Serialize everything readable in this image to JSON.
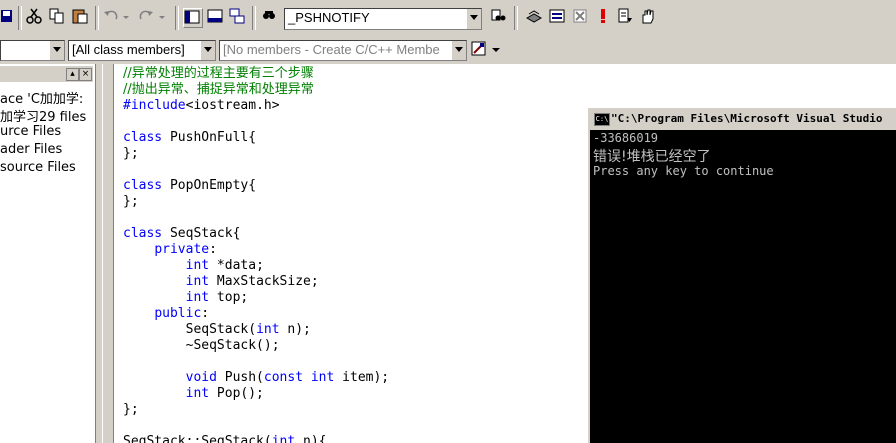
{
  "toolbar": {
    "find_combo_value": "_PSHNOTIFY"
  },
  "wizardbar": {
    "class_value": "",
    "filter_value": "[All class members]",
    "members_value": "[No members - Create C/C++ Membe"
  },
  "workspace": {
    "items": [
      "ace 'C加加学:",
      "加学习29 files",
      "urce Files",
      "ader Files",
      "source Files"
    ]
  },
  "editor": {
    "lines": [
      {
        "type": "comment",
        "text": "//异常处理的过程主要有三个步骤"
      },
      {
        "type": "comment",
        "text": "//抛出异常、捕捉异常和处理异常"
      },
      {
        "type": "include",
        "kw": "#include",
        "rest": "<iostream.h>"
      },
      {
        "type": "blank"
      },
      {
        "type": "kwline",
        "indent": "",
        "kw": "class",
        "rest": " PushOnFull{"
      },
      {
        "type": "plain",
        "text": "};"
      },
      {
        "type": "blank"
      },
      {
        "type": "kwline",
        "indent": "",
        "kw": "class",
        "rest": " PopOnEmpty{"
      },
      {
        "type": "plain",
        "text": "};"
      },
      {
        "type": "blank"
      },
      {
        "type": "kwline",
        "indent": "",
        "kw": "class",
        "rest": " SeqStack{"
      },
      {
        "type": "kwline",
        "indent": "    ",
        "kw": "private",
        "rest": ":"
      },
      {
        "type": "kwline",
        "indent": "        ",
        "kw": "int",
        "rest": " *data;"
      },
      {
        "type": "kwline",
        "indent": "        ",
        "kw": "int",
        "rest": " MaxStackSize;"
      },
      {
        "type": "kwline",
        "indent": "        ",
        "kw": "int",
        "rest": " top;"
      },
      {
        "type": "kwline",
        "indent": "    ",
        "kw": "public",
        "rest": ":"
      },
      {
        "type": "mixed",
        "parts": [
          [
            "",
            "        SeqStack("
          ],
          [
            "kw",
            "int"
          ],
          [
            "",
            " n);"
          ]
        ]
      },
      {
        "type": "plain",
        "text": "        ~SeqStack();"
      },
      {
        "type": "blank"
      },
      {
        "type": "mixed",
        "parts": [
          [
            "kw",
            "        void"
          ],
          [
            "",
            " Push("
          ],
          [
            "kw",
            "const"
          ],
          [
            "",
            " "
          ],
          [
            "kw",
            "int"
          ],
          [
            "",
            " item);"
          ]
        ]
      },
      {
        "type": "mixed",
        "parts": [
          [
            "kw",
            "        int"
          ],
          [
            "",
            " Pop();"
          ]
        ]
      },
      {
        "type": "plain",
        "text": "};"
      },
      {
        "type": "blank"
      },
      {
        "type": "mixed",
        "parts": [
          [
            "",
            "SeqStack::SeqStack("
          ],
          [
            "kw",
            "int"
          ],
          [
            "",
            " n){"
          ]
        ]
      }
    ]
  },
  "console": {
    "title": "\"C:\\Program Files\\Microsoft Visual Studio",
    "lines": [
      "-33686019",
      "错误!堆栈已经空了",
      "Press any key to continue"
    ]
  }
}
